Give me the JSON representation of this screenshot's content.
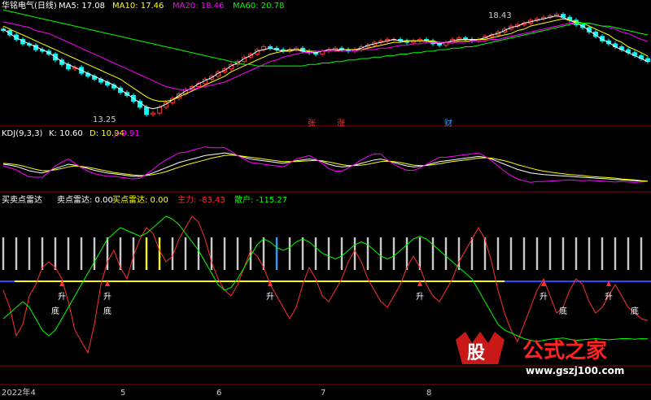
{
  "panels": {
    "price": {
      "title": "华铭电气(日线)",
      "ma_labels": [
        {
          "text": "MA5: 17.08",
          "color": "#ffffff"
        },
        {
          "text": "MA10: 17.46",
          "color": "#ffff00"
        },
        {
          "text": "MA20: 18.46",
          "color": "#ff00ff"
        },
        {
          "text": "MA60: 20.78",
          "color": "#00ff00"
        }
      ],
      "high_label": "18.43",
      "low_label": "13.25",
      "markers": [
        {
          "text": "张",
          "color": "#ff3030"
        },
        {
          "text": "涨",
          "color": "#ff3030"
        },
        {
          "text": "财",
          "color": "#3399ff"
        }
      ]
    },
    "kdj": {
      "title": "KDJ(9,3,3)",
      "labels": [
        {
          "text": "K: 10.60",
          "color": "#ffffff"
        },
        {
          "text": "D: 10.94",
          "color": "#ffff00"
        },
        {
          "text": "J: 9.91",
          "color": "#ff00ff"
        }
      ]
    },
    "radar": {
      "title": "买卖点雷达",
      "labels": [
        {
          "text": "卖点雷达: 0.00",
          "color": "#ffffff"
        },
        {
          "text": "买点雷达: 0.00",
          "color": "#ffff00"
        },
        {
          "text": "主力: -83.43",
          "color": "#ff3030"
        },
        {
          "text": "散户: -115.27",
          "color": "#00ff00"
        }
      ],
      "signal_texts": {
        "up": "升",
        "bottom": "底"
      }
    }
  },
  "x_axis": {
    "labels": [
      "2022年4",
      "5",
      "6",
      "7",
      "8"
    ]
  },
  "watermark": {
    "logo": "股",
    "text": "公式之家",
    "url": "www.gszj100.com"
  },
  "colors": {
    "up": "#ff3030",
    "down": "#00ffff",
    "ma5": "#ffffff",
    "ma10": "#ffff00",
    "ma20": "#ff00ff",
    "ma60": "#00ff00",
    "grid": "#8b0000"
  },
  "chart_data": [
    {
      "type": "line",
      "title": "华铭电气(日线)",
      "ylim": [
        13.0,
        20.5
      ],
      "x_labels": [
        "2022年4",
        "5",
        "6",
        "7",
        "8"
      ],
      "close": [
        19.2,
        18.9,
        18.6,
        18.3,
        18.2,
        17.9,
        17.8,
        17.6,
        17.2,
        16.9,
        16.6,
        16.7,
        16.3,
        16.1,
        15.9,
        15.7,
        15.5,
        15.3,
        15.0,
        14.8,
        14.4,
        14.0,
        13.5,
        13.6,
        14.0,
        14.3,
        14.6,
        14.9,
        15.2,
        15.4,
        15.6,
        15.9,
        16.1,
        16.4,
        16.6,
        16.9,
        17.1,
        17.4,
        17.6,
        17.9,
        18.1,
        18.0,
        17.9,
        17.8,
        17.9,
        18.0,
        17.8,
        17.7,
        17.6,
        17.8,
        17.9,
        18.0,
        17.9,
        17.8,
        17.9,
        18.1,
        18.2,
        18.4,
        18.5,
        18.6,
        18.6,
        18.5,
        18.4,
        18.5,
        18.6,
        18.5,
        18.3,
        18.2,
        18.4,
        18.6,
        18.7,
        18.6,
        18.5,
        18.6,
        18.8,
        18.9,
        19.1,
        19.3,
        19.5,
        19.6,
        19.7,
        19.9,
        20.0,
        20.1,
        20.2,
        20.3,
        20.1,
        19.9,
        19.6,
        19.4,
        19.1,
        18.8,
        18.5,
        18.3,
        18.1,
        17.9,
        17.7,
        17.5,
        17.3,
        17.1
      ],
      "series": [
        {
          "name": "MA5",
          "values": [
            19.3,
            19.0,
            18.7,
            18.5,
            18.3,
            18.1,
            17.9,
            17.7,
            17.4,
            17.1,
            16.9,
            16.7,
            16.5,
            16.3,
            16.1,
            15.9,
            15.7,
            15.5,
            15.2,
            14.9,
            14.6,
            14.3,
            14.0,
            13.9,
            14.0,
            14.2,
            14.5,
            14.8,
            15.1,
            15.3,
            15.6,
            15.8,
            16.0,
            16.3,
            16.5,
            16.8,
            17.0,
            17.3,
            17.5,
            17.8,
            17.9,
            18.0,
            17.9,
            17.8,
            17.9,
            17.9,
            17.8,
            17.7,
            17.7,
            17.8,
            17.9,
            17.9,
            17.9,
            17.9,
            17.9,
            18.0,
            18.2,
            18.3,
            18.4,
            18.5,
            18.6,
            18.5,
            18.5,
            18.5,
            18.5,
            18.5,
            18.4,
            18.3,
            18.4,
            18.5,
            18.6,
            18.6,
            18.6,
            18.6,
            18.7,
            18.9,
            19.0,
            19.2,
            19.4,
            19.5,
            19.7,
            19.8,
            19.9,
            20.0,
            20.1,
            20.2,
            20.1,
            19.9,
            19.7,
            19.5,
            19.2,
            18.9,
            18.6,
            18.4,
            18.1,
            17.9,
            17.7,
            17.5,
            17.3,
            17.08
          ]
        },
        {
          "name": "MA10",
          "values": [
            19.5,
            19.3,
            19.1,
            18.9,
            18.7,
            18.5,
            18.3,
            18.1,
            17.9,
            17.7,
            17.5,
            17.3,
            17.1,
            16.9,
            16.7,
            16.5,
            16.3,
            16.1,
            15.9,
            15.6,
            15.3,
            15.0,
            14.7,
            14.5,
            14.4,
            14.4,
            14.5,
            14.7,
            14.9,
            15.1,
            15.3,
            15.5,
            15.7,
            15.9,
            16.1,
            16.4,
            16.6,
            16.8,
            17.0,
            17.2,
            17.4,
            17.6,
            17.7,
            17.8,
            17.8,
            17.9,
            17.9,
            17.8,
            17.8,
            17.8,
            17.8,
            17.8,
            17.9,
            17.9,
            17.9,
            17.9,
            18.0,
            18.1,
            18.2,
            18.3,
            18.4,
            18.4,
            18.5,
            18.5,
            18.5,
            18.5,
            18.5,
            18.4,
            18.4,
            18.4,
            18.5,
            18.5,
            18.5,
            18.6,
            18.6,
            18.7,
            18.8,
            18.9,
            19.0,
            19.2,
            19.3,
            19.5,
            19.6,
            19.7,
            19.8,
            19.9,
            20.0,
            19.9,
            19.8,
            19.7,
            19.5,
            19.3,
            19.1,
            18.9,
            18.6,
            18.4,
            18.1,
            17.9,
            17.7,
            17.46
          ]
        },
        {
          "name": "MA20",
          "values": [
            19.8,
            19.7,
            19.6,
            19.5,
            19.4,
            19.2,
            19.1,
            19.0,
            18.8,
            18.6,
            18.4,
            18.2,
            18.0,
            17.8,
            17.6,
            17.4,
            17.2,
            17.0,
            16.8,
            16.6,
            16.4,
            16.2,
            16.0,
            15.8,
            15.6,
            15.4,
            15.3,
            15.2,
            15.2,
            15.2,
            15.3,
            15.4,
            15.5,
            15.6,
            15.7,
            15.9,
            16.1,
            16.3,
            16.5,
            16.7,
            16.9,
            17.1,
            17.2,
            17.4,
            17.5,
            17.6,
            17.7,
            17.7,
            17.8,
            17.8,
            17.8,
            17.8,
            17.8,
            17.8,
            17.8,
            17.9,
            17.9,
            17.9,
            18.0,
            18.0,
            18.1,
            18.2,
            18.2,
            18.3,
            18.3,
            18.4,
            18.4,
            18.4,
            18.4,
            18.4,
            18.4,
            18.4,
            18.5,
            18.5,
            18.5,
            18.6,
            18.6,
            18.7,
            18.8,
            18.9,
            19.0,
            19.1,
            19.2,
            19.3,
            19.4,
            19.5,
            19.6,
            19.7,
            19.7,
            19.7,
            19.7,
            19.6,
            19.5,
            19.4,
            19.3,
            19.1,
            19.0,
            18.8,
            18.6,
            18.46
          ]
        },
        {
          "name": "MA60",
          "values": [
            20.6,
            20.5,
            20.4,
            20.3,
            20.2,
            20.1,
            20.0,
            19.9,
            19.8,
            19.7,
            19.6,
            19.5,
            19.4,
            19.3,
            19.2,
            19.1,
            19.0,
            18.9,
            18.8,
            18.7,
            18.6,
            18.5,
            18.4,
            18.3,
            18.2,
            18.1,
            18.0,
            17.9,
            17.8,
            17.7,
            17.6,
            17.5,
            17.4,
            17.3,
            17.2,
            17.1,
            17.0,
            16.9,
            16.9,
            16.8,
            16.8,
            16.8,
            16.8,
            16.8,
            16.8,
            16.8,
            16.8,
            16.9,
            16.9,
            17.0,
            17.0,
            17.1,
            17.1,
            17.2,
            17.2,
            17.3,
            17.3,
            17.4,
            17.4,
            17.5,
            17.5,
            17.6,
            17.6,
            17.7,
            17.7,
            17.8,
            17.8,
            17.9,
            17.9,
            18.0,
            18.0,
            18.1,
            18.1,
            18.2,
            18.3,
            18.4,
            18.5,
            18.6,
            18.7,
            18.8,
            18.9,
            19.0,
            19.1,
            19.2,
            19.3,
            19.4,
            19.5,
            19.6,
            19.7,
            19.7,
            19.7,
            19.6,
            19.5,
            19.5,
            19.4,
            19.3,
            19.2,
            19.1,
            19.0,
            18.9
          ]
        }
      ]
    },
    {
      "type": "line",
      "title": "KDJ(9,3,3)",
      "ylim": [
        -10,
        110
      ],
      "series": [
        {
          "name": "K",
          "values": [
            50,
            48,
            45,
            40,
            35,
            32,
            30,
            34,
            40,
            45,
            50,
            48,
            44,
            40,
            36,
            33,
            30,
            28,
            26,
            24,
            22,
            22,
            25,
            30,
            36,
            42,
            48,
            54,
            58,
            62,
            66,
            70,
            72,
            74,
            76,
            74,
            70,
            66,
            62,
            60,
            58,
            56,
            54,
            52,
            55,
            58,
            60,
            62,
            60,
            56,
            50,
            46,
            44,
            45,
            48,
            52,
            56,
            60,
            62,
            58,
            54,
            50,
            46,
            44,
            45,
            48,
            52,
            56,
            58,
            60,
            62,
            64,
            66,
            68,
            66,
            62,
            56,
            50,
            44,
            38,
            34,
            30,
            28,
            26,
            25,
            24,
            23,
            22,
            21,
            20,
            19,
            18,
            17,
            16,
            15,
            14,
            13,
            12,
            11,
            10.6
          ]
        },
        {
          "name": "D",
          "values": [
            52,
            51,
            49,
            46,
            42,
            38,
            35,
            35,
            37,
            40,
            44,
            46,
            45,
            43,
            40,
            37,
            34,
            31,
            29,
            27,
            25,
            24,
            24,
            26,
            29,
            33,
            38,
            43,
            48,
            52,
            56,
            60,
            64,
            67,
            70,
            71,
            70,
            68,
            66,
            64,
            62,
            60,
            58,
            56,
            56,
            56,
            57,
            58,
            59,
            58,
            55,
            52,
            49,
            47,
            47,
            48,
            50,
            53,
            56,
            57,
            56,
            54,
            51,
            48,
            47,
            47,
            49,
            51,
            54,
            56,
            58,
            60,
            62,
            64,
            65,
            64,
            61,
            58,
            54,
            49,
            45,
            41,
            37,
            34,
            32,
            30,
            28,
            26,
            25,
            24,
            22,
            21,
            20,
            19,
            18,
            16,
            15,
            14,
            12,
            10.94
          ]
        },
        {
          "name": "J",
          "values": [
            46,
            42,
            37,
            28,
            21,
            20,
            20,
            32,
            46,
            55,
            62,
            52,
            42,
            34,
            28,
            25,
            22,
            22,
            20,
            18,
            16,
            18,
            27,
            38,
            50,
            60,
            68,
            76,
            78,
            82,
            86,
            90,
            88,
            88,
            88,
            80,
            70,
            62,
            54,
            52,
            50,
            48,
            46,
            44,
            53,
            62,
            66,
            70,
            62,
            52,
            40,
            34,
            34,
            41,
            50,
            60,
            68,
            74,
            74,
            60,
            50,
            42,
            36,
            36,
            41,
            50,
            58,
            66,
            66,
            68,
            70,
            72,
            74,
            76,
            68,
            58,
            46,
            34,
            24,
            16,
            12,
            8,
            10,
            10,
            11,
            12,
            13,
            14,
            13,
            12,
            13,
            12,
            11,
            10,
            9,
            10,
            9,
            8,
            9,
            9.91
          ]
        }
      ]
    },
    {
      "type": "line",
      "title": "买卖点雷达",
      "ylim": [
        -160,
        120
      ],
      "series": [
        {
          "name": "主力",
          "values": [
            -30,
            -60,
            -110,
            -90,
            -40,
            -20,
            10,
            20,
            10,
            -10,
            -50,
            -100,
            -120,
            -140,
            -90,
            -20,
            20,
            40,
            10,
            -10,
            30,
            60,
            80,
            70,
            40,
            20,
            30,
            60,
            80,
            100,
            90,
            60,
            20,
            -10,
            -30,
            -40,
            -20,
            10,
            40,
            30,
            10,
            -20,
            -40,
            -60,
            -80,
            -60,
            -20,
            10,
            -10,
            -40,
            -50,
            -30,
            -10,
            20,
            40,
            20,
            -10,
            -30,
            -50,
            -60,
            -40,
            -20,
            10,
            30,
            10,
            -20,
            -40,
            -50,
            -30,
            -10,
            20,
            40,
            60,
            80,
            60,
            20,
            -30,
            -70,
            -100,
            -120,
            -90,
            -60,
            -30,
            -10,
            -40,
            -70,
            -60,
            -30,
            -10,
            -20,
            -50,
            -70,
            -60,
            -40,
            -20,
            -40,
            -60,
            -70,
            -80,
            -83.43
          ]
        },
        {
          "name": "散户",
          "values": [
            -80,
            -70,
            -60,
            -50,
            -60,
            -80,
            -100,
            -110,
            -100,
            -80,
            -60,
            -40,
            -20,
            0,
            20,
            40,
            60,
            70,
            80,
            75,
            70,
            65,
            70,
            80,
            90,
            100,
            95,
            85,
            70,
            55,
            40,
            20,
            0,
            -20,
            -30,
            -25,
            -10,
            10,
            30,
            50,
            60,
            55,
            45,
            40,
            45,
            55,
            60,
            55,
            45,
            35,
            30,
            25,
            30,
            40,
            50,
            55,
            50,
            40,
            30,
            25,
            30,
            40,
            50,
            60,
            65,
            60,
            50,
            40,
            30,
            20,
            10,
            0,
            -10,
            -30,
            -50,
            -70,
            -90,
            -100,
            -105,
            -110,
            -115,
            -118,
            -120,
            -118,
            -116,
            -115,
            -114,
            -116,
            -118,
            -117,
            -116,
            -115,
            -116,
            -117,
            -116,
            -115,
            -115,
            -116,
            -115,
            -115.27
          ]
        }
      ]
    }
  ]
}
